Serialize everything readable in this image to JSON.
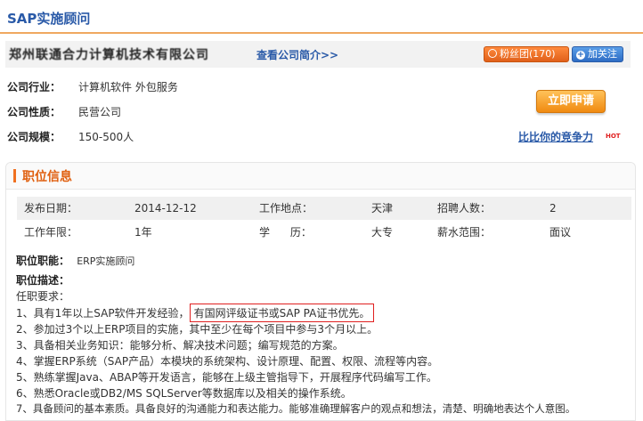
{
  "job": {
    "title": "SAP实施顾问"
  },
  "company": {
    "name": "郑州联通合力计算机技术有限公司",
    "intro_link": "查看公司简介>>",
    "fans_label": "粉丝团",
    "fans_count": "(170)",
    "follow_label": "加关注",
    "industry_label": "公司行业：",
    "industry_value": "计算机软件   外包服务",
    "nature_label": "公司性质：",
    "nature_value": "民营公司",
    "scale_label": "公司规模：",
    "scale_value": "150-500人"
  },
  "actions": {
    "apply_label": "立即申请",
    "compare_label": "比比你的竞争力",
    "hot_label": "HOT"
  },
  "position": {
    "section_title": "职位信息",
    "rows": [
      [
        {
          "label": "发布日期：",
          "value": "2014-12-12"
        },
        {
          "label": "工作地点：",
          "value": "天津"
        },
        {
          "label": "招聘人数：",
          "value": "2"
        }
      ],
      [
        {
          "label": "工作年限：",
          "value": "1年"
        },
        {
          "label": "学      历：",
          "value": "大专"
        },
        {
          "label": "薪水范围：",
          "value": "面议"
        }
      ]
    ],
    "function_label": "职位职能：",
    "function_value": "ERP实施顾问",
    "desc_label": "职位描述：",
    "requirements_heading": "任职要求：",
    "req1_prefix": "1、具有1年以上SAP软件开发经验，",
    "req1_highlight": "有国网评级证书或SAP PA证书优先。",
    "requirements": [
      "2、参加过3个以上ERP项目的实施，其中至少在每个项目中参与3个月以上。",
      "3、具备相关业务知识：能够分析、解决技术问题；编写规范的方案。",
      "4、掌握ERP系统（SAP产品）本模块的系统架构、设计原理、配置、权限、流程等内容。",
      "5、熟练掌握Java、ABAP等开发语言，能够在上级主管指导下，开展程序代码编写工作。",
      "6、熟悉Oracle或DB2/MS SQLServer等数据库以及相关的操作系统。",
      "7、具备顾问的基本素质。具备良好的沟通能力和表达能力。能够准确理解客户的观点和想法，清楚、明确地表达个人意图。"
    ]
  },
  "colors": {
    "accent": "#f07020",
    "link": "#2a5aa8",
    "highlight_border": "#e02020"
  }
}
